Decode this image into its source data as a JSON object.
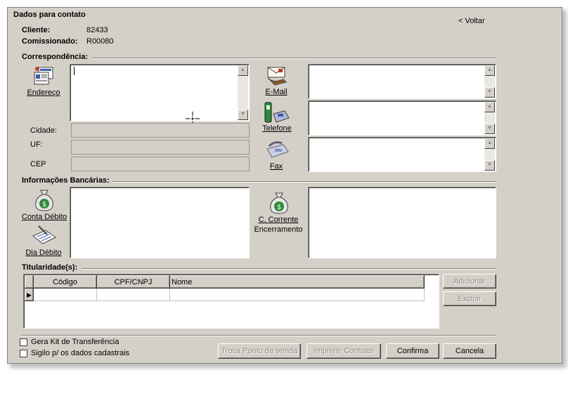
{
  "header": {
    "title": "Dados para contato",
    "back_link": "< Voltar",
    "cliente_label": "Cliente:",
    "cliente_value": "82433",
    "comissionado_label": "Comissionado:",
    "comissionado_value": "R00080"
  },
  "correspondencia": {
    "group_title": "Correspondência:",
    "endereco_label": "Endereço",
    "cidade_label": "Cidade:",
    "uf_label": "UF:",
    "cep_label": "CEP",
    "email_label": "E-Mail",
    "telefone_label": "Telefone",
    "fax_label": "Fax"
  },
  "bancarias": {
    "group_title": "Informações Bancárias:",
    "conta_debito_label": "Conta Débito",
    "dia_debito_label": "Dia Débito",
    "c_corrente_label": "C. Corrente",
    "encerramento_label": "Encerramento"
  },
  "titularidade": {
    "group_title": "Titularidade(s):",
    "columns": [
      "Código",
      "CPF/CNPJ",
      "Nome"
    ],
    "adicionar_label": "Adicionar",
    "excluir_label": "Excluir"
  },
  "footer": {
    "gera_kit_label": "Gera Kit de Transferência",
    "sigilo_label": "Sigilo p/ os dados cadastrais",
    "troca_label": "Troca Ponto de Venda",
    "imprimir_label": "Imprimir Contrato",
    "confirma_label": "Confirma",
    "cancela_label": "Cancela"
  },
  "colors": {
    "window_bg": "#d4d0c8",
    "field_bg": "#ffffff",
    "disabled_text": "#8c8a85",
    "icon_green": "#2e8b3a"
  }
}
